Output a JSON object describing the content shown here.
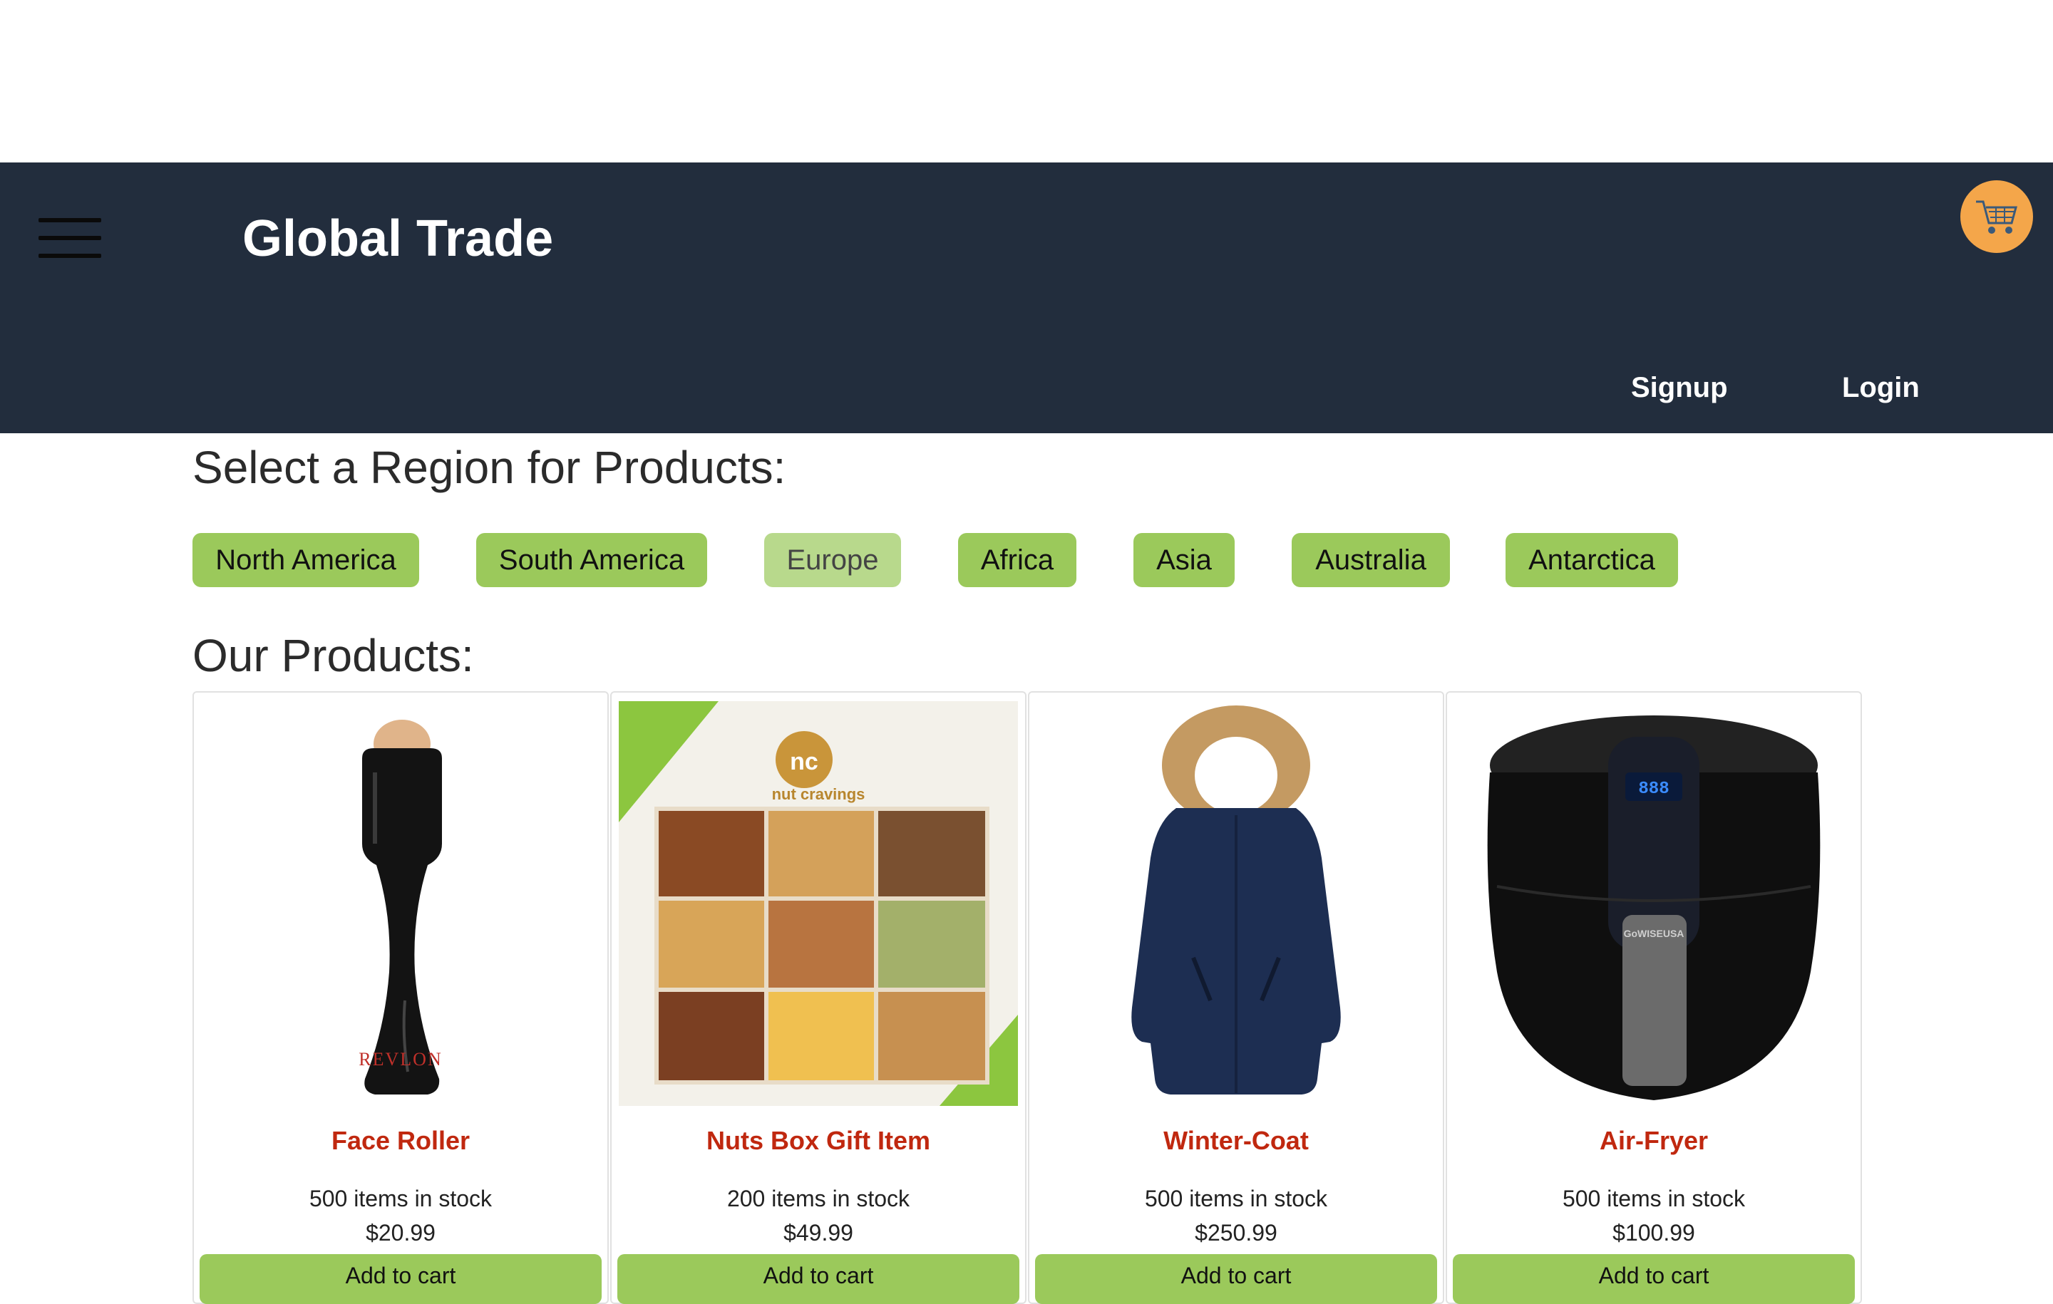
{
  "header": {
    "brand": "Global Trade",
    "signup_label": "Signup",
    "login_label": "Login",
    "menu_icon": "hamburger-menu-icon",
    "cart_icon": "shopping-cart-icon",
    "cart_color": "#f4a64a",
    "bar_color": "#222d3d"
  },
  "regions": {
    "title": "Select a Region for Products:",
    "selected": "Europe",
    "items": [
      {
        "label": "North America"
      },
      {
        "label": "South America"
      },
      {
        "label": "Europe"
      },
      {
        "label": "Africa"
      },
      {
        "label": "Asia"
      },
      {
        "label": "Australia"
      },
      {
        "label": "Antarctica"
      }
    ]
  },
  "products": {
    "title": "Our Products:",
    "add_label": "Add to cart",
    "items": [
      {
        "name": "Face Roller",
        "stock": "500 items in stock",
        "price": "$20.99",
        "brand_text": "REVLON"
      },
      {
        "name": "Nuts Box Gift Item",
        "stock": "200 items in stock",
        "price": "$49.99",
        "brand_text": "nut cravings"
      },
      {
        "name": "Winter-Coat",
        "stock": "500 items in stock",
        "price": "$250.99"
      },
      {
        "name": "Air-Fryer",
        "stock": "500 items in stock",
        "price": "$100.99",
        "brand_text": "GoWISEUSA",
        "display_text": "888"
      }
    ]
  },
  "colors": {
    "accent_green": "#9bc95b",
    "product_name": "#c0280f"
  }
}
